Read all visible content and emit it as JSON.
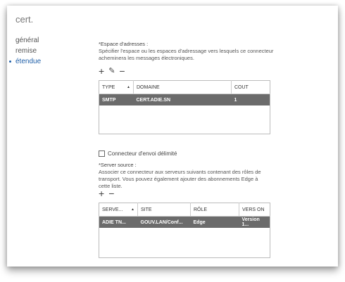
{
  "title": "cert.",
  "nav": [
    {
      "label": "général"
    },
    {
      "label": "remise"
    },
    {
      "label": "étendue"
    }
  ],
  "address_space": {
    "label": "*Espace d'adresses :",
    "description": "Spécifier l'espace ou les espaces d'adressage vers lesquels ce connecteur acheminera les messages électroniques.",
    "columns": [
      "TYPE",
      "DOMAINE",
      "COUT"
    ],
    "rows": [
      {
        "type": "SMTP",
        "domain": "CERT.ADIE.SN",
        "cost": "1"
      }
    ]
  },
  "scoped_connector": {
    "label": "Connecteur d'envoi délimité"
  },
  "source_server": {
    "label": "*Server source :",
    "description": "Associer ce connecteur aux serveurs suivants contenant des rôles de transport. Vous pouvez également ajouter des abonnements Edge à cette liste.",
    "columns": [
      "SERVE...",
      "SITE",
      "RÔLE",
      "VERS ON"
    ],
    "rows": [
      {
        "server": "ADIE TN...",
        "site": "GOUV.LAN/Conf...",
        "role": "Edge",
        "version": "Version 1..."
      }
    ]
  },
  "icons": {
    "add": "+",
    "edit": "✎",
    "remove": "−",
    "sort": "▲"
  }
}
